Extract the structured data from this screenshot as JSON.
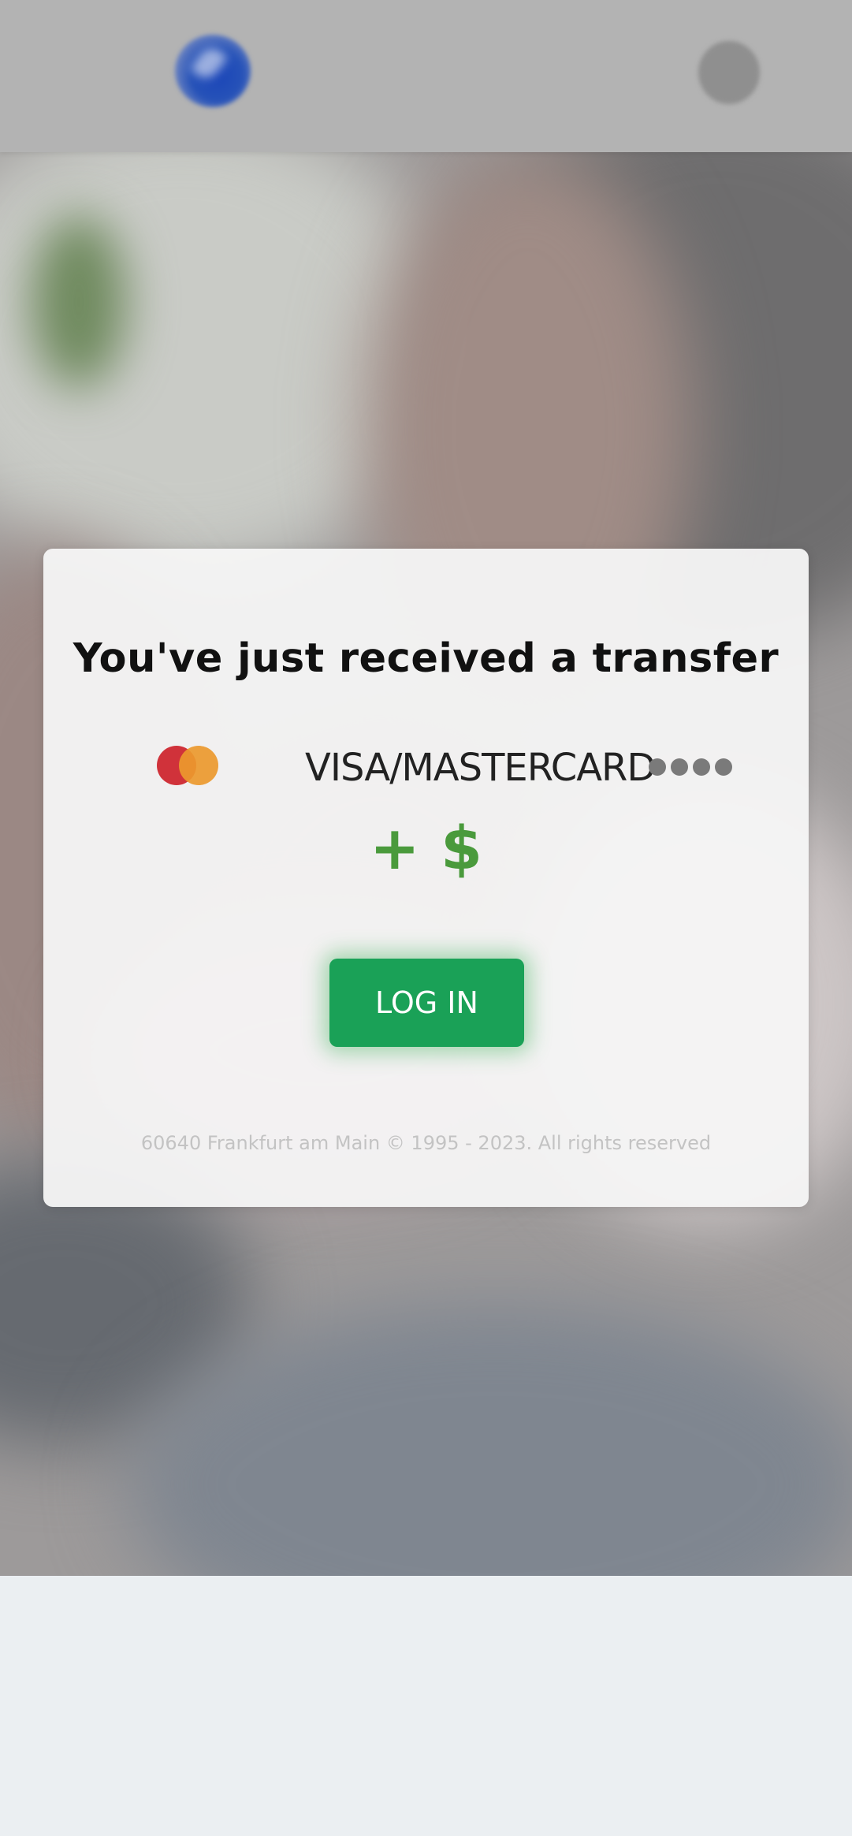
{
  "header": {
    "logo_icon": "bank-logo-icon",
    "menu_icon": "menu-icon"
  },
  "hero": {
    "background": "blurred-photo"
  },
  "card": {
    "title": "You've just received a transfer",
    "card_brand_icon": "mastercard-icon",
    "card_label": "VISA/MASTERCARD",
    "masked_digits_icon": "masked-dots",
    "amount": "+ $",
    "login_button": "LOG IN",
    "footer_text": "60640 Frankfurt am Main © 1995 - 2023. All rights reserved"
  },
  "colors": {
    "accent_green": "#1aa157",
    "amount_green": "#4a9a3c",
    "header_gray": "#b3b3b3",
    "page_background": "#ebeff2"
  }
}
